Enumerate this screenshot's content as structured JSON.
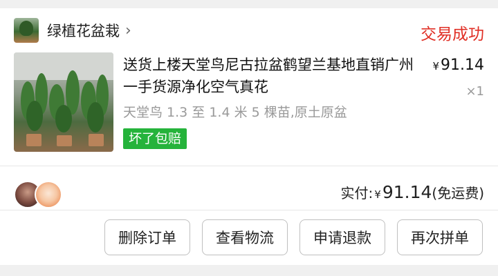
{
  "store": {
    "name": "绿植花盆栽",
    "status": "交易成功"
  },
  "product": {
    "title": "送货上楼天堂鸟尼古拉盆鹤望兰基地直销广州一手货源净化空气真花",
    "price": "91.14",
    "currency": "¥",
    "quantity": "×1",
    "spec": "天堂鸟 1.3 至 1.4 米 5 棵苗,原土原盆",
    "badge": "坏了包赔"
  },
  "summary": {
    "label": "实付:",
    "currency": "¥",
    "amount": "91.14",
    "shipping": "(免运费)"
  },
  "actions": {
    "delete": "删除订单",
    "logistics": "查看物流",
    "refund": "申请退款",
    "reorder": "再次拼单"
  },
  "colors": {
    "status": "#e02e24",
    "badge": "#25b33b"
  }
}
